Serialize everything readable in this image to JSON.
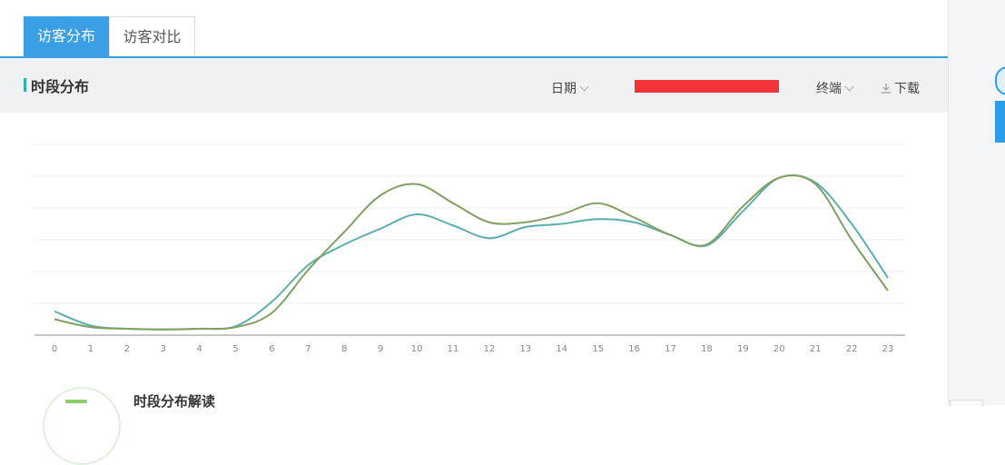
{
  "tabs": [
    {
      "label": "访客分布",
      "active": true
    },
    {
      "label": "访客对比",
      "active": false
    }
  ],
  "section": {
    "title": "时段分布"
  },
  "toolbar": {
    "date_label": "日期",
    "terminal_label": "终端",
    "download_label": "下载"
  },
  "interpretation": {
    "title": "时段分布解读"
  },
  "colors": {
    "accent": "#3a9fe4",
    "series_teal": "#5aaeb0",
    "series_olive": "#82a062",
    "redaction": "#f5343a"
  },
  "chart_data": {
    "type": "line",
    "x": [
      "0",
      "1",
      "2",
      "3",
      "4",
      "5",
      "6",
      "7",
      "8",
      "9",
      "10",
      "11",
      "12",
      "13",
      "14",
      "15",
      "16",
      "17",
      "18",
      "19",
      "20",
      "21",
      "22",
      "23"
    ],
    "ylim": [
      0,
      6
    ],
    "grid": true,
    "legend": "none",
    "series": [
      {
        "color": "#5aaeb0",
        "values": [
          0.75,
          0.3,
          0.2,
          0.18,
          0.2,
          0.28,
          1.05,
          2.2,
          2.85,
          3.35,
          3.8,
          3.45,
          3.05,
          3.4,
          3.5,
          3.65,
          3.55,
          3.15,
          2.82,
          3.9,
          4.95,
          4.8,
          3.5,
          1.8
        ]
      },
      {
        "color": "#82a062",
        "values": [
          0.5,
          0.25,
          0.2,
          0.18,
          0.2,
          0.25,
          0.7,
          2.05,
          3.25,
          4.4,
          4.75,
          4.15,
          3.55,
          3.55,
          3.8,
          4.15,
          3.7,
          3.15,
          2.85,
          4.05,
          4.95,
          4.75,
          3.0,
          1.4
        ]
      }
    ]
  }
}
